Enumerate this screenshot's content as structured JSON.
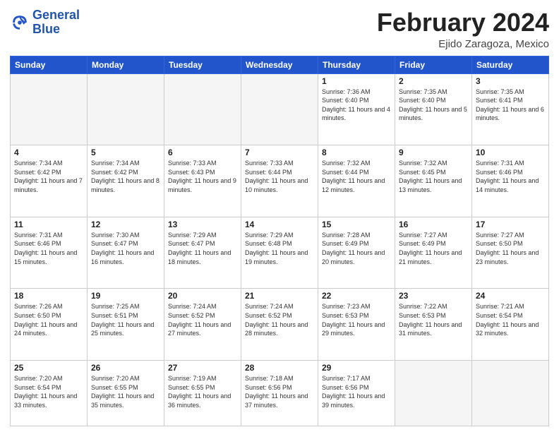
{
  "header": {
    "logo_line1": "General",
    "logo_line2": "Blue",
    "title": "February 2024",
    "location": "Ejido Zaragoza, Mexico"
  },
  "days_of_week": [
    "Sunday",
    "Monday",
    "Tuesday",
    "Wednesday",
    "Thursday",
    "Friday",
    "Saturday"
  ],
  "weeks": [
    [
      {
        "day": "",
        "info": ""
      },
      {
        "day": "",
        "info": ""
      },
      {
        "day": "",
        "info": ""
      },
      {
        "day": "",
        "info": ""
      },
      {
        "day": "1",
        "info": "Sunrise: 7:36 AM\nSunset: 6:40 PM\nDaylight: 11 hours and 4 minutes."
      },
      {
        "day": "2",
        "info": "Sunrise: 7:35 AM\nSunset: 6:40 PM\nDaylight: 11 hours and 5 minutes."
      },
      {
        "day": "3",
        "info": "Sunrise: 7:35 AM\nSunset: 6:41 PM\nDaylight: 11 hours and 6 minutes."
      }
    ],
    [
      {
        "day": "4",
        "info": "Sunrise: 7:34 AM\nSunset: 6:42 PM\nDaylight: 11 hours and 7 minutes."
      },
      {
        "day": "5",
        "info": "Sunrise: 7:34 AM\nSunset: 6:42 PM\nDaylight: 11 hours and 8 minutes."
      },
      {
        "day": "6",
        "info": "Sunrise: 7:33 AM\nSunset: 6:43 PM\nDaylight: 11 hours and 9 minutes."
      },
      {
        "day": "7",
        "info": "Sunrise: 7:33 AM\nSunset: 6:44 PM\nDaylight: 11 hours and 10 minutes."
      },
      {
        "day": "8",
        "info": "Sunrise: 7:32 AM\nSunset: 6:44 PM\nDaylight: 11 hours and 12 minutes."
      },
      {
        "day": "9",
        "info": "Sunrise: 7:32 AM\nSunset: 6:45 PM\nDaylight: 11 hours and 13 minutes."
      },
      {
        "day": "10",
        "info": "Sunrise: 7:31 AM\nSunset: 6:46 PM\nDaylight: 11 hours and 14 minutes."
      }
    ],
    [
      {
        "day": "11",
        "info": "Sunrise: 7:31 AM\nSunset: 6:46 PM\nDaylight: 11 hours and 15 minutes."
      },
      {
        "day": "12",
        "info": "Sunrise: 7:30 AM\nSunset: 6:47 PM\nDaylight: 11 hours and 16 minutes."
      },
      {
        "day": "13",
        "info": "Sunrise: 7:29 AM\nSunset: 6:47 PM\nDaylight: 11 hours and 18 minutes."
      },
      {
        "day": "14",
        "info": "Sunrise: 7:29 AM\nSunset: 6:48 PM\nDaylight: 11 hours and 19 minutes."
      },
      {
        "day": "15",
        "info": "Sunrise: 7:28 AM\nSunset: 6:49 PM\nDaylight: 11 hours and 20 minutes."
      },
      {
        "day": "16",
        "info": "Sunrise: 7:27 AM\nSunset: 6:49 PM\nDaylight: 11 hours and 21 minutes."
      },
      {
        "day": "17",
        "info": "Sunrise: 7:27 AM\nSunset: 6:50 PM\nDaylight: 11 hours and 23 minutes."
      }
    ],
    [
      {
        "day": "18",
        "info": "Sunrise: 7:26 AM\nSunset: 6:50 PM\nDaylight: 11 hours and 24 minutes."
      },
      {
        "day": "19",
        "info": "Sunrise: 7:25 AM\nSunset: 6:51 PM\nDaylight: 11 hours and 25 minutes."
      },
      {
        "day": "20",
        "info": "Sunrise: 7:24 AM\nSunset: 6:52 PM\nDaylight: 11 hours and 27 minutes."
      },
      {
        "day": "21",
        "info": "Sunrise: 7:24 AM\nSunset: 6:52 PM\nDaylight: 11 hours and 28 minutes."
      },
      {
        "day": "22",
        "info": "Sunrise: 7:23 AM\nSunset: 6:53 PM\nDaylight: 11 hours and 29 minutes."
      },
      {
        "day": "23",
        "info": "Sunrise: 7:22 AM\nSunset: 6:53 PM\nDaylight: 11 hours and 31 minutes."
      },
      {
        "day": "24",
        "info": "Sunrise: 7:21 AM\nSunset: 6:54 PM\nDaylight: 11 hours and 32 minutes."
      }
    ],
    [
      {
        "day": "25",
        "info": "Sunrise: 7:20 AM\nSunset: 6:54 PM\nDaylight: 11 hours and 33 minutes."
      },
      {
        "day": "26",
        "info": "Sunrise: 7:20 AM\nSunset: 6:55 PM\nDaylight: 11 hours and 35 minutes."
      },
      {
        "day": "27",
        "info": "Sunrise: 7:19 AM\nSunset: 6:55 PM\nDaylight: 11 hours and 36 minutes."
      },
      {
        "day": "28",
        "info": "Sunrise: 7:18 AM\nSunset: 6:56 PM\nDaylight: 11 hours and 37 minutes."
      },
      {
        "day": "29",
        "info": "Sunrise: 7:17 AM\nSunset: 6:56 PM\nDaylight: 11 hours and 39 minutes."
      },
      {
        "day": "",
        "info": ""
      },
      {
        "day": "",
        "info": ""
      }
    ]
  ]
}
